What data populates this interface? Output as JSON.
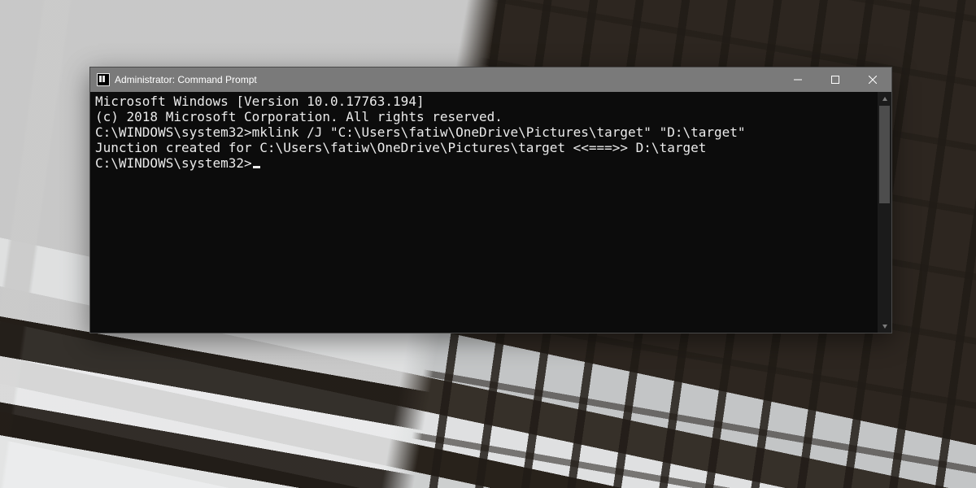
{
  "titlebar": {
    "title": "Administrator: Command Prompt"
  },
  "console": {
    "banner_line1": "Microsoft Windows [Version 10.0.17763.194]",
    "banner_line2": "(c) 2018 Microsoft Corporation. All rights reserved.",
    "blank1": "",
    "prompt1_path": "C:\\WINDOWS\\system32>",
    "command1": "mklink /J \"C:\\Users\\fatiw\\OneDrive\\Pictures\\target\" \"D:\\target\"",
    "output1": "Junction created for C:\\Users\\fatiw\\OneDrive\\Pictures\\target <<===>> D:\\target",
    "blank2": "",
    "prompt2_path": "C:\\WINDOWS\\system32>",
    "command2": ""
  }
}
